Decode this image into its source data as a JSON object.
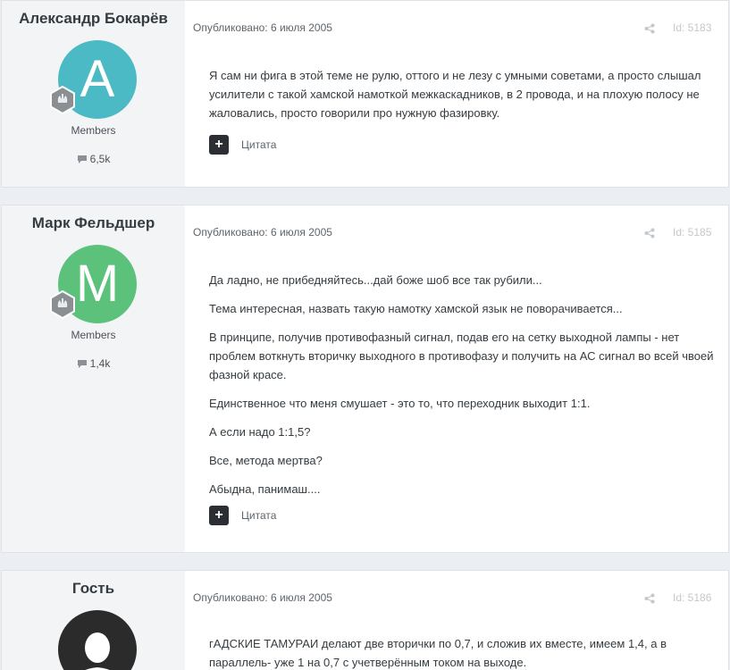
{
  "posts": [
    {
      "author": "Александр Бокарёв",
      "avatar_letter": "A",
      "avatar_color": "#4bbac4",
      "group": "Members",
      "post_count": "6,5k",
      "published": "Опубликовано: 6 июля 2005",
      "post_id": "Id: 5183",
      "paragraphs": [
        "Я сам ни фига в этой теме не рулю, оттого и не лезу с умными советами, а просто слышал усилители с такой хамской намоткой межкаскадников, в 2 провода, и на плохую полосу не жаловались, просто говорили про нужную фазировку."
      ],
      "quote_label": "Цитата"
    },
    {
      "author": "Марк Фельдшер",
      "avatar_letter": "M",
      "avatar_color": "#5cc17b",
      "group": "Members",
      "post_count": "1,4k",
      "published": "Опубликовано: 6 июля 2005",
      "post_id": "Id: 5185",
      "paragraphs": [
        "Да ладно, не прибедняйтесь...дай боже шоб все так рубили...",
        "Тема интересная, назвать такую намотку хамской язык не поворачивается...",
        "В принципе, получив противофазный сигнал, подав его на сетку выходной лампы - нет проблем воткнуть вторичку выходного в противофазу и получить на АС сигнал во всей чвоей фазной красе.",
        "Единственное что меня смушает - это то, что переходник выходит 1:1.",
        "А если надо 1:1,5?",
        "Все, метода мертва?",
        "Абыдна, панимаш...."
      ],
      "quote_label": "Цитата"
    },
    {
      "author": "Гость",
      "avatar_icon": "guest-silhouette-icon",
      "avatar_color": "#2b2b2b",
      "published": "Опубликовано: 6 июля 2005",
      "post_id": "Id: 5186",
      "paragraphs": [
        "гАДСКИЕ ТАМУРАИ делают две вторички по 0,7, и сложив их вместе, имеем 1,4, а в параллель- уже 1 на 0,7 с учетверённым током на выходе."
      ]
    }
  ]
}
